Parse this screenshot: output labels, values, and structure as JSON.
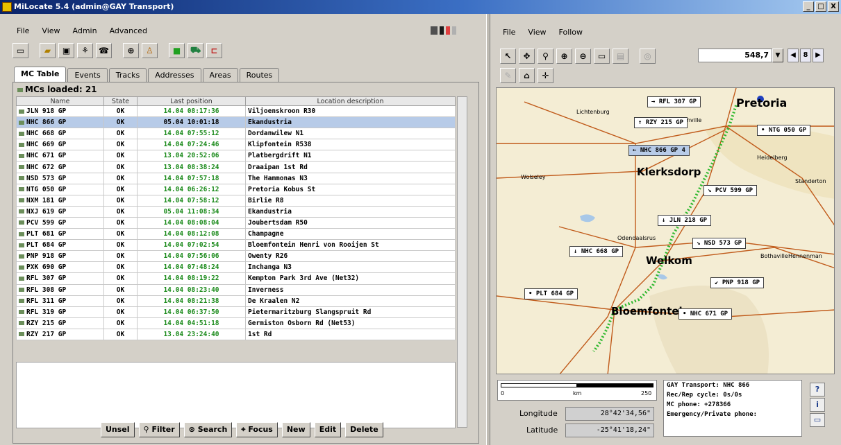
{
  "window": {
    "title": "MiLocate 5.4 (admin@GAY Transport)",
    "controls": [
      "_",
      "□",
      "X"
    ]
  },
  "left_menu": [
    "File",
    "View",
    "Admin",
    "Advanced"
  ],
  "right_menu": [
    "File",
    "View",
    "Follow"
  ],
  "tabs": [
    "MC Table",
    "Events",
    "Tracks",
    "Addresses",
    "Areas",
    "Routes"
  ],
  "mcs_loaded": "MCs loaded: 21",
  "table": {
    "headers": [
      "Name",
      "State",
      "Last position",
      "Location description"
    ],
    "rows": [
      {
        "name": "JLN 918 GP",
        "state": "OK",
        "pos": "14.04 08:17:36",
        "loc": "Viljoenskroon R30"
      },
      {
        "name": "NHC 866 GP",
        "state": "OK",
        "pos": "05.04 10:01:18",
        "loc": "Ekandustria"
      },
      {
        "name": "NHC 668 GP",
        "state": "OK",
        "pos": "14.04 07:55:12",
        "loc": "Dordanwilew N1"
      },
      {
        "name": "NHC 669 GP",
        "state": "OK",
        "pos": "14.04 07:24:46",
        "loc": "Klipfontein R538"
      },
      {
        "name": "NHC 671 GP",
        "state": "OK",
        "pos": "13.04 20:52:06",
        "loc": "Platbergdrift N1"
      },
      {
        "name": "NHC 672 GP",
        "state": "OK",
        "pos": "13.04 08:38:24",
        "loc": "Draaipan 1st Rd"
      },
      {
        "name": "NSD 573 GP",
        "state": "OK",
        "pos": "14.04 07:57:18",
        "loc": "The Hammonas N3"
      },
      {
        "name": "NTG 050 GP",
        "state": "OK",
        "pos": "14.04 06:26:12",
        "loc": "Pretoria Kobus St"
      },
      {
        "name": "NXM 181 GP",
        "state": "OK",
        "pos": "14.04 07:58:12",
        "loc": "Birlie R8"
      },
      {
        "name": "NXJ 619 GP",
        "state": "OK",
        "pos": "05.04 11:08:34",
        "loc": "Ekandustria"
      },
      {
        "name": "PCV 599 GP",
        "state": "OK",
        "pos": "14.04 08:08:04",
        "loc": "Joubertsdam R50"
      },
      {
        "name": "PLT 681 GP",
        "state": "OK",
        "pos": "14.04 08:12:08",
        "loc": "Champagne"
      },
      {
        "name": "PLT 684 GP",
        "state": "OK",
        "pos": "14.04 07:02:54",
        "loc": "Bloemfontein Henri von Rooijen St"
      },
      {
        "name": "PNP 918 GP",
        "state": "OK",
        "pos": "14.04 07:56:06",
        "loc": "Owenty R26"
      },
      {
        "name": "PXK 690 GP",
        "state": "OK",
        "pos": "14.04 07:48:24",
        "loc": "Inchanga N3"
      },
      {
        "name": "RFL 307 GP",
        "state": "OK",
        "pos": "14.04 08:19:22",
        "loc": "Kempton Park 3rd Ave (Net32)"
      },
      {
        "name": "RFL 308 GP",
        "state": "OK",
        "pos": "14.04 08:23:40",
        "loc": "Inverness"
      },
      {
        "name": "RFL 311 GP",
        "state": "OK",
        "pos": "14.04 08:21:38",
        "loc": "De Kraalen N2"
      },
      {
        "name": "RFL 319 GP",
        "state": "OK",
        "pos": "14.04 06:37:50",
        "loc": "Pietermaritzburg Slangspruit Rd"
      },
      {
        "name": "RZY 215 GP",
        "state": "OK",
        "pos": "14.04 04:51:18",
        "loc": "Germiston Osborn Rd (Net53)"
      },
      {
        "name": "RZY 217 GP",
        "state": "OK",
        "pos": "13.04 23:24:40",
        "loc": "1st Rd"
      }
    ]
  },
  "bottom_buttons": [
    "Unsel",
    "Filter",
    "Search",
    "Focus",
    "New",
    "Edit",
    "Delete"
  ],
  "zoom_value": "548,7",
  "page_nav": [
    "◀",
    "8",
    "▶"
  ],
  "map": {
    "cities": [
      "Pretoria",
      "Klerksdorp",
      "Welkom",
      "Bloemfontein"
    ],
    "small_places": [
      "Lichtenburg",
      "Carletonville",
      "Heidelberg",
      "Wolseley",
      "Odendaalsrus",
      "Hennenman",
      "Bothaville",
      "Standerton"
    ],
    "vehicle_labels": [
      "RFL 307 GP",
      "RZY 215 GP",
      "NTG 050 GP",
      "NHC 866 GP",
      "PCV 599 GP",
      "JLN 218 GP",
      "NSD 573 GP",
      "NHC 668 GP",
      "PNP 918 GP",
      "PLT 684 GP",
      "NHC 671 GP"
    ],
    "colors": {
      "land": "#f4edd4",
      "road": "#c05a1a",
      "water": "#a8c8e8",
      "track": "#2eb82e",
      "selected": "#b7cbe8"
    }
  },
  "scale": {
    "min": "0",
    "unit": "km",
    "max": "250"
  },
  "coords": {
    "lon_label": "Longitude",
    "lon_value": "28°42'34,56\"",
    "lat_label": "Latitude",
    "lat_value": "-25°41'18,24\""
  },
  "info_lines": [
    "GAY Transport: NHC 866",
    "Rec/Rep cycle: 0s/0s",
    "MC phone: +278366",
    "Emergency/Private phone:"
  ],
  "side_buttons": [
    "?",
    "i",
    "▭"
  ]
}
